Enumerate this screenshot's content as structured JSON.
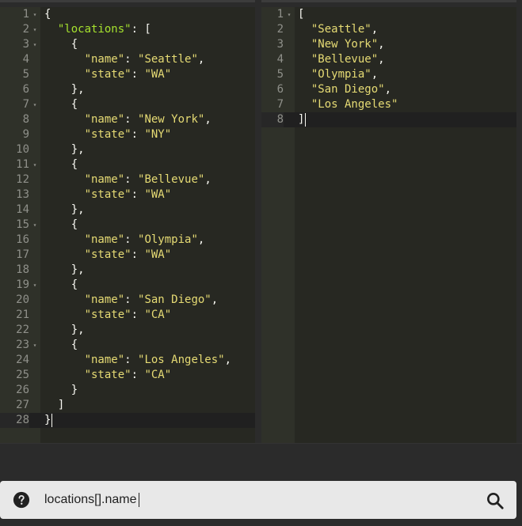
{
  "input_editor": {
    "lines": [
      {
        "n": "1",
        "fold": true,
        "tokens": [
          [
            "punc",
            "{"
          ]
        ]
      },
      {
        "n": "2",
        "fold": true,
        "tokens": [
          [
            "punc",
            "  "
          ],
          [
            "key",
            "\"locations\""
          ],
          [
            "punc",
            ": ["
          ]
        ]
      },
      {
        "n": "3",
        "fold": true,
        "tokens": [
          [
            "punc",
            "    {"
          ]
        ]
      },
      {
        "n": "4",
        "fold": false,
        "tokens": [
          [
            "punc",
            "      "
          ],
          [
            "str",
            "\"name\""
          ],
          [
            "punc",
            ": "
          ],
          [
            "str",
            "\"Seattle\""
          ],
          [
            "punc",
            ","
          ]
        ]
      },
      {
        "n": "5",
        "fold": false,
        "tokens": [
          [
            "punc",
            "      "
          ],
          [
            "str",
            "\"state\""
          ],
          [
            "punc",
            ": "
          ],
          [
            "str",
            "\"WA\""
          ]
        ]
      },
      {
        "n": "6",
        "fold": false,
        "tokens": [
          [
            "punc",
            "    },"
          ]
        ]
      },
      {
        "n": "7",
        "fold": true,
        "tokens": [
          [
            "punc",
            "    {"
          ]
        ]
      },
      {
        "n": "8",
        "fold": false,
        "tokens": [
          [
            "punc",
            "      "
          ],
          [
            "str",
            "\"name\""
          ],
          [
            "punc",
            ": "
          ],
          [
            "str",
            "\"New York\""
          ],
          [
            "punc",
            ","
          ]
        ]
      },
      {
        "n": "9",
        "fold": false,
        "tokens": [
          [
            "punc",
            "      "
          ],
          [
            "str",
            "\"state\""
          ],
          [
            "punc",
            ": "
          ],
          [
            "str",
            "\"NY\""
          ]
        ]
      },
      {
        "n": "10",
        "fold": false,
        "tokens": [
          [
            "punc",
            "    },"
          ]
        ]
      },
      {
        "n": "11",
        "fold": true,
        "tokens": [
          [
            "punc",
            "    {"
          ]
        ]
      },
      {
        "n": "12",
        "fold": false,
        "tokens": [
          [
            "punc",
            "      "
          ],
          [
            "str",
            "\"name\""
          ],
          [
            "punc",
            ": "
          ],
          [
            "str",
            "\"Bellevue\""
          ],
          [
            "punc",
            ","
          ]
        ]
      },
      {
        "n": "13",
        "fold": false,
        "tokens": [
          [
            "punc",
            "      "
          ],
          [
            "str",
            "\"state\""
          ],
          [
            "punc",
            ": "
          ],
          [
            "str",
            "\"WA\""
          ]
        ]
      },
      {
        "n": "14",
        "fold": false,
        "tokens": [
          [
            "punc",
            "    },"
          ]
        ]
      },
      {
        "n": "15",
        "fold": true,
        "tokens": [
          [
            "punc",
            "    {"
          ]
        ]
      },
      {
        "n": "16",
        "fold": false,
        "tokens": [
          [
            "punc",
            "      "
          ],
          [
            "str",
            "\"name\""
          ],
          [
            "punc",
            ": "
          ],
          [
            "str",
            "\"Olympia\""
          ],
          [
            "punc",
            ","
          ]
        ]
      },
      {
        "n": "17",
        "fold": false,
        "tokens": [
          [
            "punc",
            "      "
          ],
          [
            "str",
            "\"state\""
          ],
          [
            "punc",
            ": "
          ],
          [
            "str",
            "\"WA\""
          ]
        ]
      },
      {
        "n": "18",
        "fold": false,
        "tokens": [
          [
            "punc",
            "    },"
          ]
        ]
      },
      {
        "n": "19",
        "fold": true,
        "tokens": [
          [
            "punc",
            "    {"
          ]
        ]
      },
      {
        "n": "20",
        "fold": false,
        "tokens": [
          [
            "punc",
            "      "
          ],
          [
            "str",
            "\"name\""
          ],
          [
            "punc",
            ": "
          ],
          [
            "str",
            "\"San Diego\""
          ],
          [
            "punc",
            ","
          ]
        ]
      },
      {
        "n": "21",
        "fold": false,
        "tokens": [
          [
            "punc",
            "      "
          ],
          [
            "str",
            "\"state\""
          ],
          [
            "punc",
            ": "
          ],
          [
            "str",
            "\"CA\""
          ]
        ]
      },
      {
        "n": "22",
        "fold": false,
        "tokens": [
          [
            "punc",
            "    },"
          ]
        ]
      },
      {
        "n": "23",
        "fold": true,
        "tokens": [
          [
            "punc",
            "    {"
          ]
        ]
      },
      {
        "n": "24",
        "fold": false,
        "tokens": [
          [
            "punc",
            "      "
          ],
          [
            "str",
            "\"name\""
          ],
          [
            "punc",
            ": "
          ],
          [
            "str",
            "\"Los Angeles\""
          ],
          [
            "punc",
            ","
          ]
        ]
      },
      {
        "n": "25",
        "fold": false,
        "tokens": [
          [
            "punc",
            "      "
          ],
          [
            "str",
            "\"state\""
          ],
          [
            "punc",
            ": "
          ],
          [
            "str",
            "\"CA\""
          ]
        ]
      },
      {
        "n": "26",
        "fold": false,
        "tokens": [
          [
            "punc",
            "    }"
          ]
        ]
      },
      {
        "n": "27",
        "fold": false,
        "tokens": [
          [
            "punc",
            "  ]"
          ]
        ]
      },
      {
        "n": "28",
        "fold": false,
        "active": true,
        "cursor": true,
        "tokens": [
          [
            "punc",
            "}"
          ]
        ]
      }
    ]
  },
  "output_editor": {
    "lines": [
      {
        "n": "1",
        "fold": true,
        "tokens": [
          [
            "punc",
            "["
          ]
        ]
      },
      {
        "n": "2",
        "fold": false,
        "tokens": [
          [
            "punc",
            "  "
          ],
          [
            "str",
            "\"Seattle\""
          ],
          [
            "punc",
            ","
          ]
        ]
      },
      {
        "n": "3",
        "fold": false,
        "tokens": [
          [
            "punc",
            "  "
          ],
          [
            "str",
            "\"New York\""
          ],
          [
            "punc",
            ","
          ]
        ]
      },
      {
        "n": "4",
        "fold": false,
        "tokens": [
          [
            "punc",
            "  "
          ],
          [
            "str",
            "\"Bellevue\""
          ],
          [
            "punc",
            ","
          ]
        ]
      },
      {
        "n": "5",
        "fold": false,
        "tokens": [
          [
            "punc",
            "  "
          ],
          [
            "str",
            "\"Olympia\""
          ],
          [
            "punc",
            ","
          ]
        ]
      },
      {
        "n": "6",
        "fold": false,
        "tokens": [
          [
            "punc",
            "  "
          ],
          [
            "str",
            "\"San Diego\""
          ],
          [
            "punc",
            ","
          ]
        ]
      },
      {
        "n": "7",
        "fold": false,
        "tokens": [
          [
            "punc",
            "  "
          ],
          [
            "str",
            "\"Los Angeles\""
          ]
        ]
      },
      {
        "n": "8",
        "fold": false,
        "active": true,
        "cursor": true,
        "tokens": [
          [
            "punc",
            "]"
          ]
        ]
      }
    ]
  },
  "query_bar": {
    "value": "locations[].name",
    "help_icon": "help-circle-icon",
    "search_icon": "search-icon"
  },
  "colors": {
    "editor_bg": "#272822",
    "gutter_bg": "#2f3129",
    "string": "#e6db74",
    "key": "#a6e22e",
    "text": "#f8f8f2",
    "query_bar_bg": "#e8e8e8"
  }
}
